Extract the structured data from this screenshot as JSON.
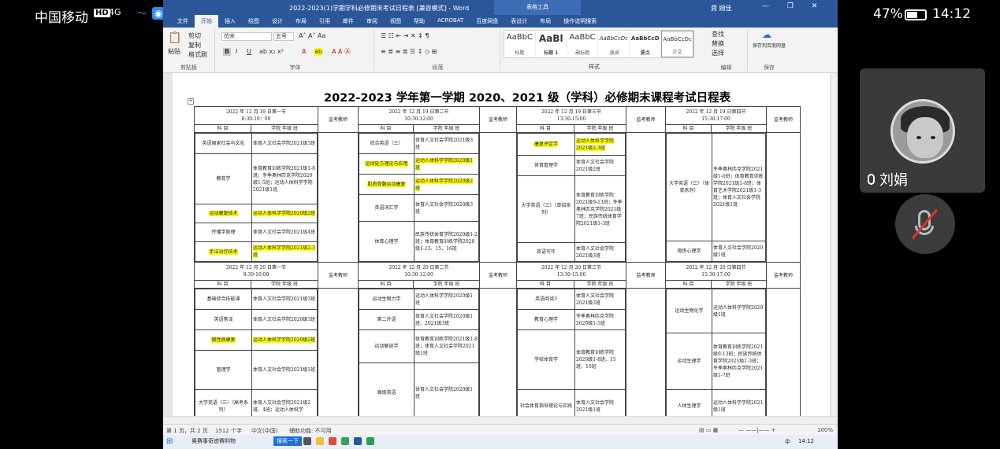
{
  "phone_status": {
    "carrier": "中国移动",
    "hd": "HD",
    "signal": "4G",
    "battery": "47%",
    "time": "14:12"
  },
  "word": {
    "doc_title": "2022-2023(1)学期学科必修期末考试日程表 [兼容模式] - Word",
    "context_tab": "表格工具",
    "user": "龚 婉佳",
    "window_controls": "— ❐ ✕",
    "tabs": [
      "文件",
      "开始",
      "插入",
      "绘图",
      "设计",
      "布局",
      "引用",
      "邮件",
      "审阅",
      "视图",
      "帮助",
      "ACROBAT",
      "百度网盘",
      "表设计",
      "布局",
      "操作说明搜索"
    ],
    "ribbon": {
      "paste": "粘贴",
      "cut": "剪切",
      "copy": "复制",
      "format_painter": "格式刷",
      "font_name": "仿宋",
      "font_size": "五号",
      "group_clipboard": "剪贴板",
      "group_font": "字体",
      "group_paragraph": "段落",
      "group_styles": "样式",
      "group_editing": "编辑",
      "group_save": "保存",
      "find": "查找",
      "replace": "替换",
      "select": "选择",
      "save_baidu": "保存到百度网盘",
      "styles": [
        {
          "sample": "AaBbC",
          "name": "标题"
        },
        {
          "sample": "AaBl",
          "name": "标题 1"
        },
        {
          "sample": "AaBbC",
          "name": "副标题"
        },
        {
          "sample": "AaBbCcDc",
          "name": "强调"
        },
        {
          "sample": "AaBbCcD",
          "name": "要点"
        },
        {
          "sample": "AaBbCcDc",
          "name": "正文"
        }
      ]
    },
    "document": {
      "title": "2022-2023 学年第一学期 2020、2021 级（学科）必修期末课程考试日程表"
    },
    "statusbar": {
      "page": "第 1 页，共 2 页",
      "words": "1512 个字",
      "lang": "中文(中国)",
      "access": "辅助功能: 不可用",
      "zoom": "100%"
    },
    "taskbar": {
      "search": "奥赛事奇迹赛利物",
      "search_btn": "搜索一下",
      "ime": "中",
      "clock": "14:12"
    }
  },
  "schedule": {
    "day1": {
      "slots": [
        {
          "date": "2022 年 12 月 19 日第一节",
          "time": "8:30-10：00"
        },
        {
          "date": "2022 年 12 月 19 日第二节",
          "time": "10:30-12:00"
        },
        {
          "date": "2022 年 12 月 19 日第三节",
          "time": "13:30-15:00"
        },
        {
          "date": "2022 年 12 月 19 日第四节",
          "time": "15:30-17:00"
        }
      ],
      "proctor": "监考教师",
      "col_subject": "科 目",
      "col_class": "学院 年级 班",
      "s1": [
        {
          "subj": "英语国家社会与文化",
          "cls": "体育人文社会学院2021级3班"
        },
        {
          "subj": "教育学",
          "cls": "体育教育训练学院2021级1-8班；冬季奥林匹克学院2020级1-5班；运动人体科学学院2021级1班"
        },
        {
          "subj": "运动康复技术",
          "cls": "运动人体科学学院2020级2班"
        },
        {
          "subj": "传播学原理",
          "cls": "体育人文社会学院2021级4班"
        },
        {
          "subj": "手法治疗技术",
          "cls": "运动人体科学学院2021级2-3班"
        }
      ],
      "s2": [
        {
          "subj": "综合英语（三）",
          "cls": "体育人文社会学院2021级3班"
        },
        {
          "subj": "运动处方理论与应用",
          "cls": "运动人体科学学院2020级1班"
        },
        {
          "subj": "肌肉骨骼运动康复",
          "cls": "运动人体科学学院2020级2班"
        },
        {
          "subj": "英语词汇学",
          "cls": "体育人文社会学院2020级3班"
        },
        {
          "subj": "体育心理学",
          "cls": "民族传统体育学院2020级1-2班；体育教育训练学院2020级1-13、15、16班"
        }
      ],
      "s3": [
        {
          "subj": "康复评定学",
          "cls": "运动人体科学学院2021级2-3班"
        },
        {
          "subj": "体育管理学",
          "cls": "体育人文社会学院2021级2班"
        },
        {
          "subj": "大学英语（三）（单招系列）",
          "cls": "体育教育训练学院2021级9-13班；冬季奥林匹克学院2021级7班；民族传统体育学院2021级1-3班"
        },
        {
          "subj": "英语写作",
          "cls": "体育人文社会学院2021级3班"
        }
      ],
      "s4": [
        {
          "subj": "大学英语（三）（体育系列）",
          "cls": "冬季奥林匹克学院2021级1-6班；体育教育训练学院2021级1-8班；体育艺术学院2021级1-3班；体育人文社会学院2021级1班"
        },
        {
          "subj": "锻炼心理学",
          "cls": "体育人文社会学院2020级1班"
        }
      ]
    },
    "day2": {
      "slots": [
        {
          "date": "2022 年 12 月 20 日第一节",
          "time": "8:30-10:00"
        },
        {
          "date": "2022 年 12 月 20 日第二节",
          "time": "10:30-12:00"
        },
        {
          "date": "2022 年 12 月 20 日第三节",
          "time": "13:30-15:00"
        },
        {
          "date": "2022 年 12 月 20 日第四节",
          "time": "15:30-17:00"
        }
      ],
      "s1": [
        {
          "subj": "基础综合技能课",
          "cls": "体育人文社会学院2021级3班"
        },
        {
          "subj": "英语笔译",
          "cls": "体育人文社会学院2020级3班"
        },
        {
          "subj": "慢性病康复",
          "cls": "运动人体科学学院2020级2班"
        },
        {
          "subj": "管理学",
          "cls": "体育人文社会学院2021级1班"
        },
        {
          "subj": "大学英语（三）（高考系列）",
          "cls": "体育人文社会学院2021级2班、4班；运动人体科学"
        }
      ],
      "s2": [
        {
          "subj": "运动生物力学",
          "cls": "运动人体科学学院2020级1班"
        },
        {
          "subj": "第二外语",
          "cls": "体育人文社会学院2020级1班、2021级3班"
        },
        {
          "subj": "运动解剖学",
          "cls": "体育教育训练学院2021级1-8班；体育人文社会学院2021级1班"
        },
        {
          "subj": "高级英语",
          "cls": "体育人文社会学院2020级1班"
        }
      ],
      "s3": [
        {
          "subj": "英语阅读3",
          "cls": "体育人文社会学院2021级3班"
        },
        {
          "subj": "教育心理学",
          "cls": "冬季奥林匹克学院2020级1-5班"
        },
        {
          "subj": "学校体育学",
          "cls": "体育教育训练学院2020级1-8班、15班、16班"
        },
        {
          "subj": "社会体育指导理论与实践",
          "cls": "体育人文社会学院2021级1班"
        }
      ],
      "s4": [
        {
          "subj": "运动生物化学",
          "cls": "运动人体科学学院2020级1班"
        },
        {
          "subj": "运动生理学",
          "cls": "体育教育训练学院2021级9-13班；民族传统体育学院2021级1-3班；冬季奥林匹克学院2021级1-7班"
        },
        {
          "subj": "人体生理学",
          "cls": "运动人体科学学院2021级1班"
        }
      ]
    }
  },
  "meeting": {
    "participant": "刘娟"
  },
  "colors": {
    "word_blue": "#2b579a",
    "highlight": "#ffff00",
    "mute_red": "#e0322a"
  }
}
